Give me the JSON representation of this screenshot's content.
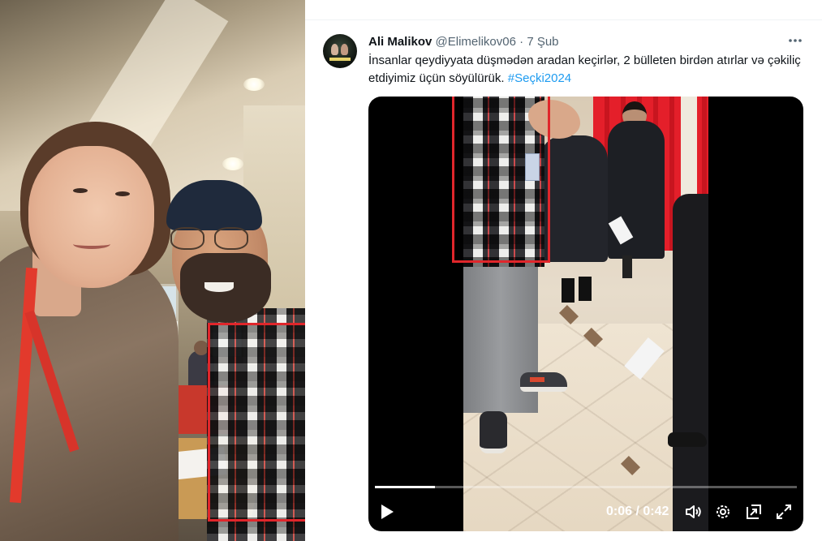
{
  "tweet": {
    "author_name": "Ali Malikov",
    "author_handle": "@Elimelikov06",
    "separator": "·",
    "time": "7 Şub",
    "more_icon": "more-horizontal-icon",
    "text_main": "İnsanlar qeydiyyata düşmədən aradan keçirlər, 2 bülleten birdən atırlar və çəkiliç etdiyimiz üçün söyülürük. ",
    "hashtag": "#Seçki2024",
    "hashtag_color": "#1d9bf0"
  },
  "video": {
    "current_time": "0:06",
    "duration": "0:42",
    "time_readout": "0:06 / 0:42",
    "progress_fraction": 0.143,
    "controls": [
      "play-icon",
      "volume-icon",
      "settings-icon",
      "pip-icon",
      "fullscreen-icon"
    ]
  },
  "colors": {
    "highlight_box": "#e0262b",
    "text_primary": "#0f1419",
    "text_secondary": "#536471"
  }
}
